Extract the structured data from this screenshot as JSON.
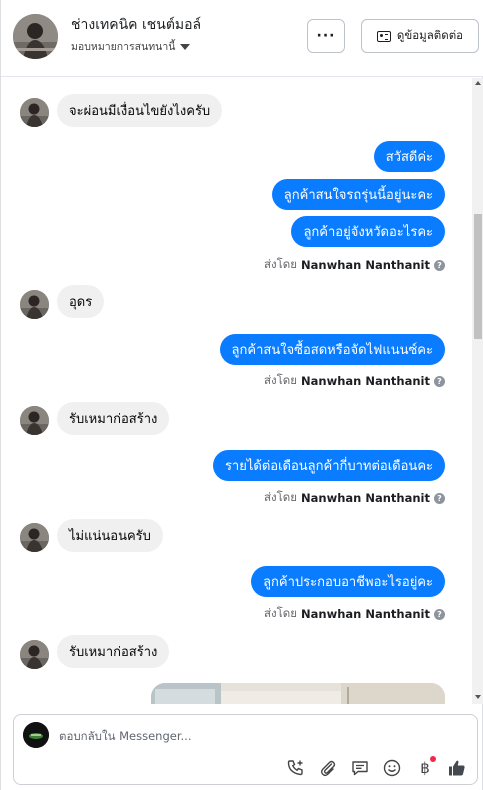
{
  "header": {
    "contact_name": "ช่างเทคนิค เชนต์มอล์",
    "assign_label": "มอบหมายการสนทนานี้",
    "more_label": "···",
    "contact_info_label": "ดูข้อมูลติดต่อ"
  },
  "messages": [
    {
      "direction": "in",
      "text": "จะผ่อนมีเงื่อนไขยังไงครับ"
    },
    {
      "direction": "out",
      "text": "สวัสดีค่ะ"
    },
    {
      "direction": "out",
      "text": "ลูกค้าสนใจรถรุ่นนี้อยู่นะคะ"
    },
    {
      "direction": "out",
      "text": "ลูกค้าอยู่จังหวัดอะไรคะ"
    },
    {
      "direction": "in",
      "text": "อุดร"
    },
    {
      "direction": "out",
      "text": "ลูกค้าสนใจซื้อสดหรือจัดไฟแนนซ์คะ"
    },
    {
      "direction": "in",
      "text": "รับเหมาก่อสร้าง"
    },
    {
      "direction": "out",
      "text": "รายได้ต่อเดือนลูกค้ากี่บาทต่อเดือนคะ"
    },
    {
      "direction": "in",
      "text": "ไม่แน่นอนครับ"
    },
    {
      "direction": "out",
      "text": "ลูกค้าประกอบอาชีพอะไรอยู่คะ"
    },
    {
      "direction": "in",
      "text": "รับเหมาก่อสร้าง"
    }
  ],
  "sent_by": {
    "prefix": "ส่งโดย",
    "name": "Nanwhan Nanthanit",
    "help_icon": "?"
  },
  "composer": {
    "placeholder": "ตอบกลับใน Messenger..."
  },
  "icons": {
    "more": "more-icon",
    "contact": "contact-card-icon",
    "assign": "caret-down-icon",
    "help": "question-icon",
    "call": "phone-add-icon",
    "attach": "paperclip-icon",
    "saved_replies": "chat-bubble-icon",
    "emoji": "smile-icon",
    "payment": "baht-icon",
    "like": "thumbs-up-icon"
  },
  "colors": {
    "outgoing_bubble": "#0a7cff",
    "incoming_bubble": "#f0f0f0",
    "like_icon": "#444950",
    "notification_dot": "#f02849"
  },
  "payment_symbol": "฿"
}
